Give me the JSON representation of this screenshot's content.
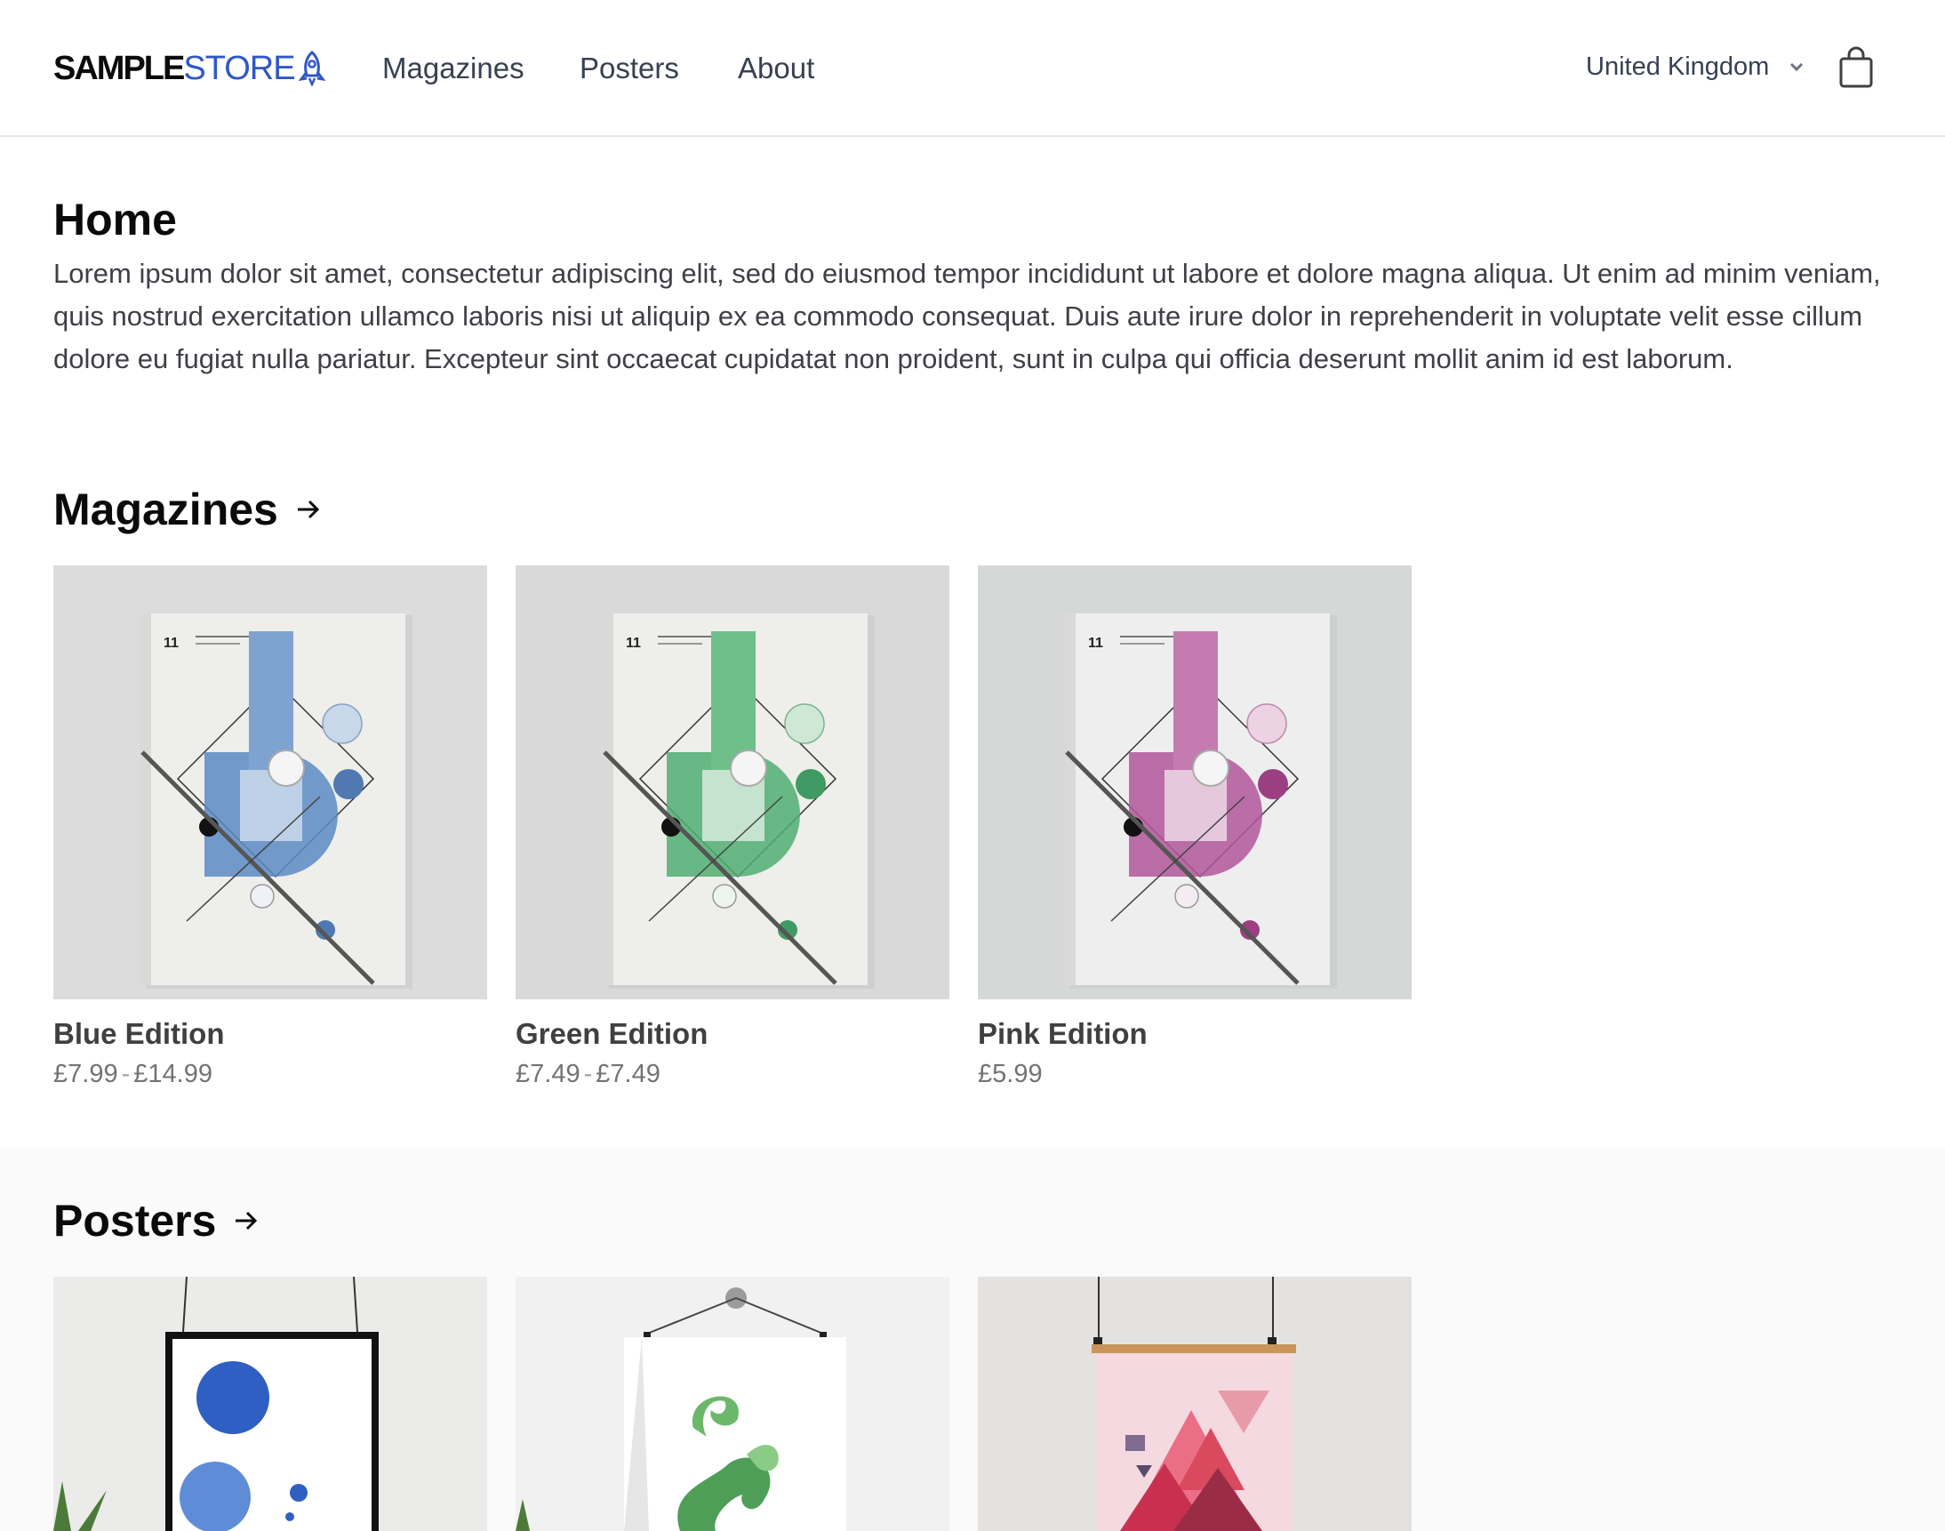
{
  "brand": {
    "part1": "SAMPLE",
    "part2": "STORE",
    "icon": "rocket-icon",
    "accent": "#2f57c7"
  },
  "nav": {
    "items": [
      "Magazines",
      "Posters",
      "About"
    ]
  },
  "region": {
    "selected": "United Kingdom",
    "icon": "chevron-down-icon"
  },
  "cart": {
    "icon": "shopping-bag-icon"
  },
  "home": {
    "title": "Home",
    "text": "Lorem ipsum dolor sit amet, consectetur adipiscing elit, sed do eiusmod tempor incididunt ut labore et dolore magna aliqua. Ut enim ad minim veniam, quis nostrud exercitation ullamco laboris nisi ut aliquip ex ea commodo consequat. Duis aute irure dolor in reprehenderit in voluptate velit esse cillum dolore eu fugiat nulla pariatur. Excepteur sint occaecat cupidatat non proident, sunt in culpa qui officia deserunt mollit anim id est laborum."
  },
  "magazines": {
    "title": "Magazines",
    "products": [
      {
        "name": "Blue Edition",
        "price_from": "£7.99",
        "price_sep": "-",
        "price_to": "£14.99",
        "color": "#5b8ac4"
      },
      {
        "name": "Green Edition",
        "price_from": "£7.49",
        "price_sep": "-",
        "price_to": "£7.49",
        "color": "#4fae72"
      },
      {
        "name": "Pink Edition",
        "price_from": "£5.99",
        "color": "#b2569a"
      }
    ]
  },
  "posters": {
    "title": "Posters"
  }
}
